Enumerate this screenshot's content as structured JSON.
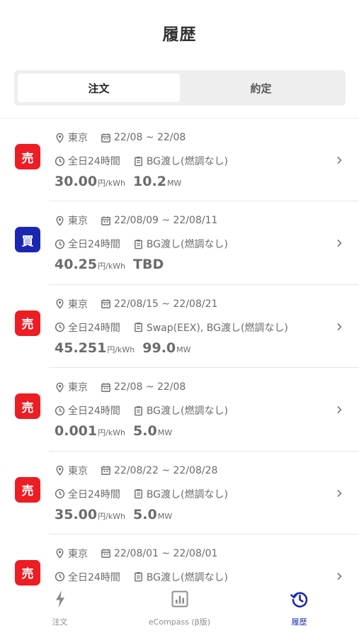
{
  "header": {
    "title": "履歴"
  },
  "segment": {
    "order_label": "注文",
    "contract_label": "約定",
    "active": "order"
  },
  "orders": [
    {
      "side": "売",
      "side_type": "sell",
      "area": "東京",
      "period": "22/08 ~ 22/08",
      "time": "全日24時間",
      "delivery": "BG渡し(燃調なし)",
      "price": "30.00",
      "price_unit": "円/kWh",
      "volume": "10.2",
      "volume_unit": "MW"
    },
    {
      "side": "買",
      "side_type": "buy",
      "area": "東京",
      "period": "22/08/09 ~ 22/08/11",
      "time": "全日24時間",
      "delivery": "BG渡し(燃調なし)",
      "price": "40.25",
      "price_unit": "円/kWh",
      "volume": "TBD",
      "volume_unit": ""
    },
    {
      "side": "売",
      "side_type": "sell",
      "area": "東京",
      "period": "22/08/15 ~ 22/08/21",
      "time": "全日24時間",
      "delivery": "Swap(EEX), BG渡し(燃調なし)",
      "price": "45.251",
      "price_unit": "円/kWh",
      "volume": "99.0",
      "volume_unit": "MW"
    },
    {
      "side": "売",
      "side_type": "sell",
      "area": "東京",
      "period": "22/08 ~ 22/08",
      "time": "全日24時間",
      "delivery": "BG渡し(燃調なし)",
      "price": "0.001",
      "price_unit": "円/kWh",
      "volume": "5.0",
      "volume_unit": "MW"
    },
    {
      "side": "売",
      "side_type": "sell",
      "area": "東京",
      "period": "22/08/22 ~ 22/08/28",
      "time": "全日24時間",
      "delivery": "BG渡し(燃調なし)",
      "price": "35.00",
      "price_unit": "円/kWh",
      "volume": "5.0",
      "volume_unit": "MW"
    },
    {
      "side": "売",
      "side_type": "sell",
      "area": "東京",
      "period": "22/08/01 ~ 22/08/01",
      "time": "全日24時間",
      "delivery": "BG渡し(燃調なし)",
      "price": "",
      "price_unit": "",
      "volume": "",
      "volume_unit": ""
    }
  ],
  "tabbar": {
    "items": [
      {
        "label": "注文",
        "icon": "bolt-icon",
        "active": false
      },
      {
        "label": "eCompass (β版)",
        "icon": "chart-icon",
        "active": false
      },
      {
        "label": "履歴",
        "icon": "history-icon",
        "active": true
      }
    ]
  },
  "colors": {
    "sell": "#ee1c23",
    "buy": "#1b27b3",
    "active_tab": "#1b27b3",
    "text": "#6b6b6b"
  }
}
